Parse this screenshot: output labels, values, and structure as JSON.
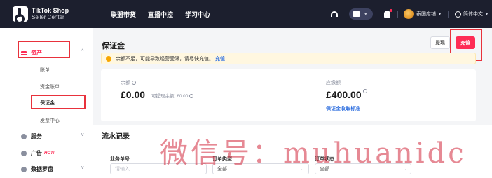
{
  "brand": {
    "line1": "TikTok Shop",
    "line2": "Seller Center"
  },
  "nav": [
    "联盟带货",
    "直播中控",
    "学习中心"
  ],
  "header_right": {
    "store": "泰国店铺",
    "language": "简体中文"
  },
  "sidebar": {
    "assets": {
      "label": "资产",
      "chevron": "^"
    },
    "sub_items": [
      "账单",
      "资金账单",
      "保证金",
      "发票中心"
    ],
    "active_sub": "保证金",
    "groups": [
      {
        "label": "服务",
        "chevron": "v"
      },
      {
        "label": "广告",
        "badge": "HOT!"
      },
      {
        "label": "数据罗盘",
        "chevron": "v"
      }
    ]
  },
  "main": {
    "title": "保证金",
    "withdraw_label": "提现",
    "topup_label": "充值",
    "alert": {
      "text": "余额不足，可能导致经营受限，请尽快充值。",
      "link": "充值"
    },
    "balance": {
      "label": "余额",
      "value": "£0.00",
      "withdrawable": "可提现余额: £0.00"
    },
    "payable": {
      "label": "应缴额",
      "value": "£400.00",
      "link": "保证金收取标准"
    }
  },
  "records": {
    "title": "流水记录",
    "filters": [
      {
        "label": "业务单号",
        "placeholder": "请输入"
      },
      {
        "label": "订单类型",
        "value": "全部"
      },
      {
        "label": "订单状态",
        "value": "全部"
      }
    ]
  },
  "watermark": "微信号：muhuanidc",
  "colors": {
    "brand": "#fe2c55",
    "link": "#2f6fdf",
    "warning": "#f7a600",
    "annotation": "#e8323c"
  }
}
